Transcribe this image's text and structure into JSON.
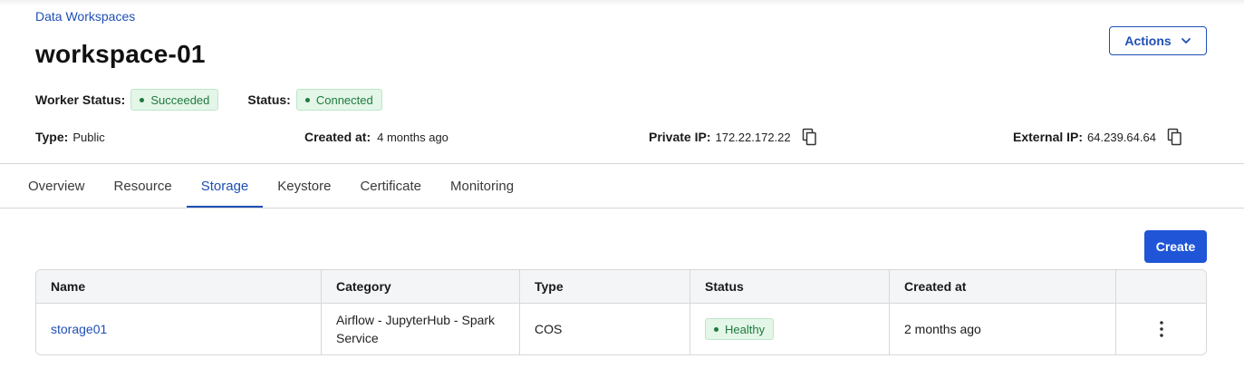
{
  "breadcrumb": "Data Workspaces",
  "title": "workspace-01",
  "actions_label": "Actions",
  "status": {
    "worker_label": "Worker Status:",
    "worker_value": "Succeeded",
    "status_label": "Status:",
    "status_value": "Connected"
  },
  "info": {
    "type_label": "Type:",
    "type_value": "Public",
    "created_label": "Created at:",
    "created_value": "4 months ago",
    "private_ip_label": "Private IP:",
    "private_ip_value": "172.22.172.22",
    "external_ip_label": "External IP:",
    "external_ip_value": "64.239.64.64"
  },
  "tabs": [
    "Overview",
    "Resource",
    "Storage",
    "Keystore",
    "Certificate",
    "Monitoring"
  ],
  "active_tab": "Storage",
  "create_label": "Create",
  "table": {
    "headers": [
      "Name",
      "Category",
      "Type",
      "Status",
      "Created at"
    ],
    "rows": [
      {
        "name": "storage01",
        "category": "Airflow - JupyterHub - Spark Service",
        "type": "COS",
        "status": "Healthy",
        "created": "2 months ago"
      }
    ]
  },
  "colors": {
    "accent": "#1f4fb5",
    "primary_button": "#1f55d6",
    "success_bg": "#e3f6e8",
    "success_text": "#1f7a3d"
  },
  "icons": {
    "actions": "chevron-down-icon",
    "copy": "copy-icon",
    "row_menu": "kebab-menu-icon"
  }
}
